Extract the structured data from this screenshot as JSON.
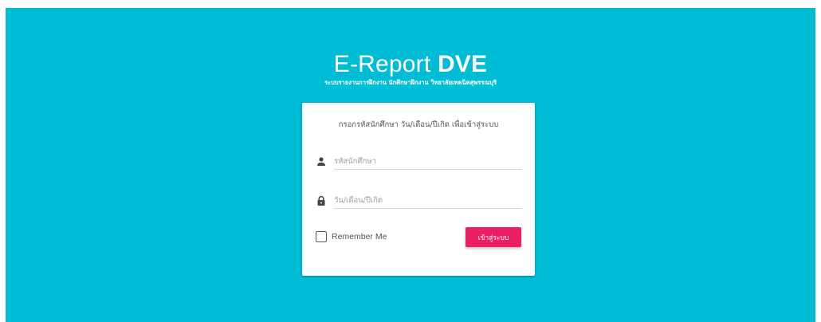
{
  "brand": {
    "title_light": "E-Report ",
    "title_bold": "DVE",
    "subtitle": "ระบบรายงานการฝึกงาน นักศึกษาฝึกงาน วิทยาลัยเทคนิคสุพรรณบุรี"
  },
  "login": {
    "message": "กรอกรหัสนักศึกษา วัน/เดือน/ปีเกิด เพื่อเข้าสู่ระบบ",
    "username": {
      "placeholder": "รหัสนักศึกษา",
      "value": "",
      "icon": "person-icon"
    },
    "password": {
      "placeholder": "วัน/เดือน/ปีเกิด",
      "value": "",
      "icon": "lock-icon"
    },
    "remember_label": "Remember Me",
    "remember_checked": false,
    "submit_label": "เข้าสู่ระบบ"
  },
  "colors": {
    "background": "#00bcd4",
    "button": "#e91e63",
    "card": "#ffffff"
  }
}
